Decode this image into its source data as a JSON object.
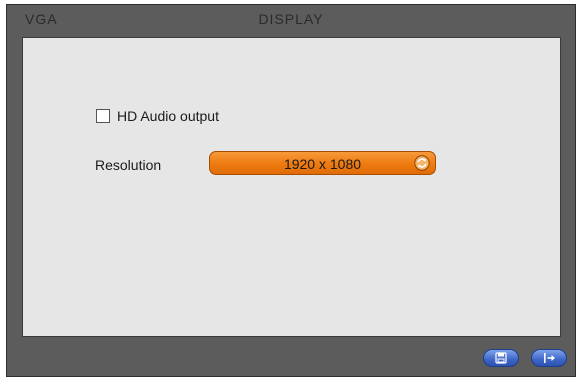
{
  "window": {
    "title_left": "VGA",
    "title_center": "DISPLAY"
  },
  "settings": {
    "hd_audio": {
      "label": "HD Audio output",
      "checked": false
    },
    "resolution": {
      "label": "Resolution",
      "value": "1920 x 1080"
    }
  },
  "footer": {
    "buttons": [
      {
        "name": "save",
        "icon": "floppy-disk-icon"
      },
      {
        "name": "exit",
        "icon": "exit-arrow-icon"
      }
    ]
  },
  "colors": {
    "frame": "#5c5c5c",
    "panel": "#e6e6e6",
    "accent_orange": "#ee7a10",
    "button_blue": "#3d66c8"
  }
}
